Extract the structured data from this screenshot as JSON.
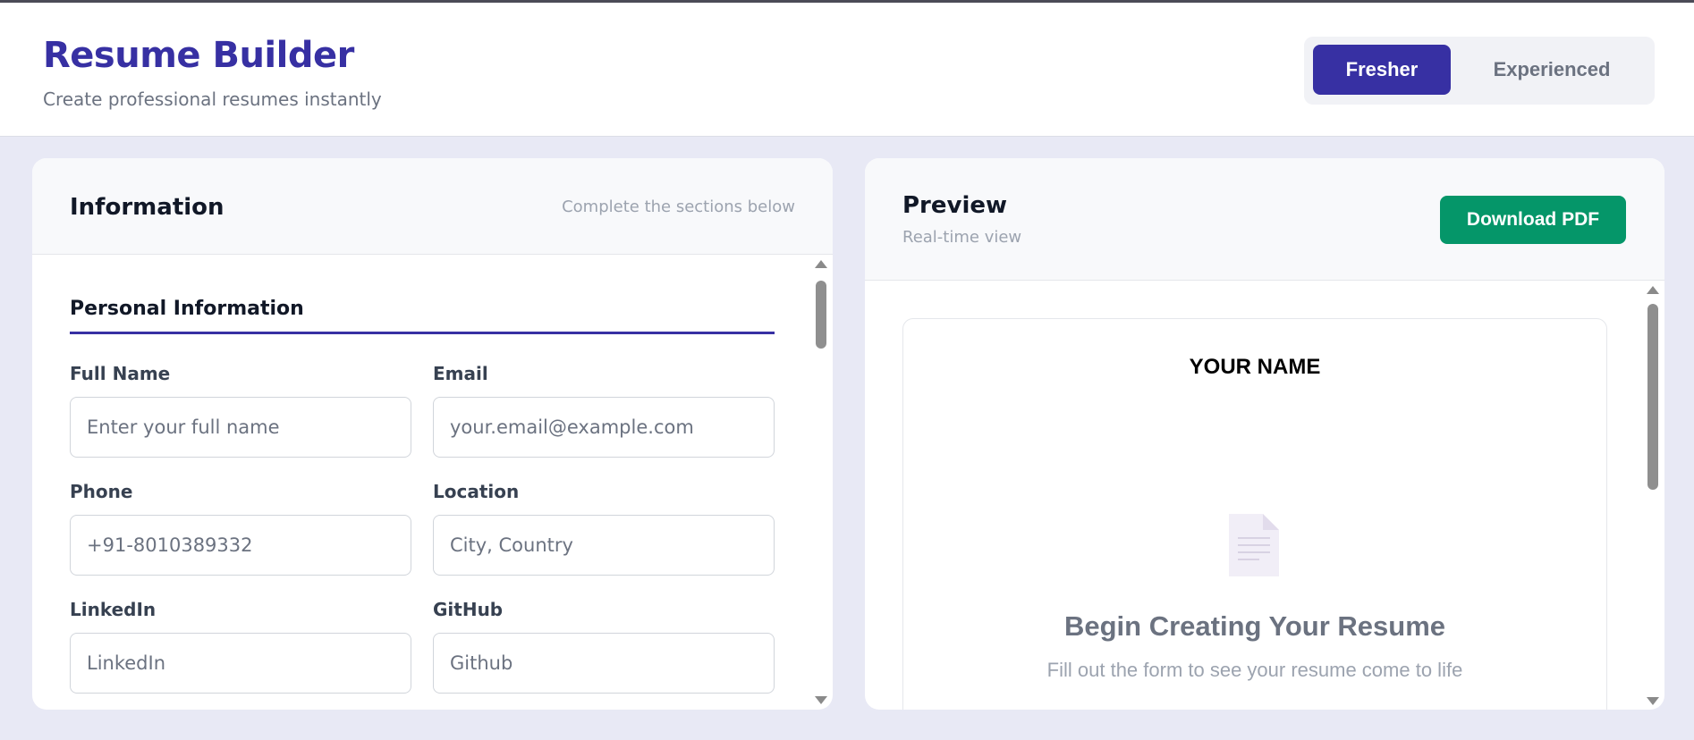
{
  "header": {
    "title": "Resume Builder",
    "subtitle": "Create professional resumes instantly",
    "modes": {
      "active": "Fresher",
      "inactive": "Experienced"
    }
  },
  "form_panel": {
    "title": "Information",
    "hint": "Complete the sections below",
    "section_title": "Personal Information",
    "fields": {
      "full_name": {
        "label": "Full Name",
        "placeholder": "Enter your full name"
      },
      "email": {
        "label": "Email",
        "placeholder": "your.email@example.com"
      },
      "phone": {
        "label": "Phone",
        "placeholder": "+91-8010389332"
      },
      "location": {
        "label": "Location",
        "placeholder": "City, Country"
      },
      "linkedin": {
        "label": "LinkedIn",
        "placeholder": "LinkedIn"
      },
      "github": {
        "label": "GitHub",
        "placeholder": "Github"
      }
    }
  },
  "preview_panel": {
    "title": "Preview",
    "subtitle": "Real-time view",
    "download_label": "Download PDF",
    "resume_name": "YOUR NAME",
    "empty_icon": "document-icon",
    "empty_title": "Begin Creating Your Resume",
    "empty_desc": "Fill out the form to see your resume come to life"
  },
  "colors": {
    "brand": "#3730a3",
    "download": "#059669",
    "background": "#e8e9f5"
  }
}
